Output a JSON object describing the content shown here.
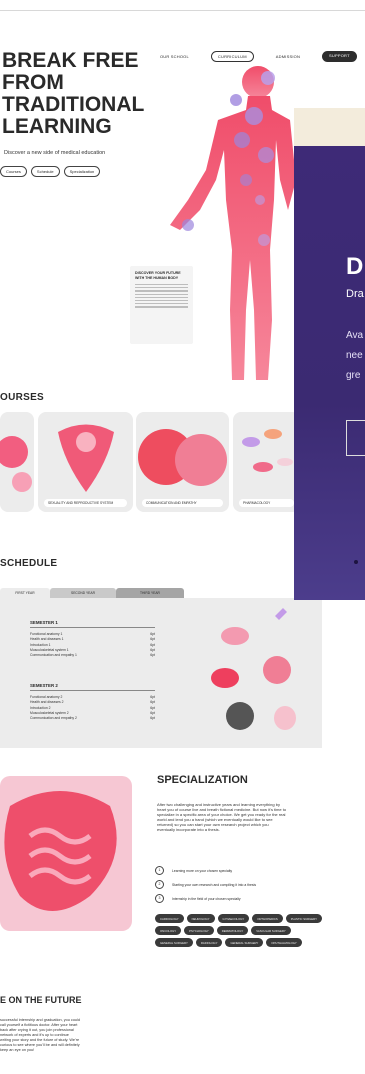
{
  "nav": {
    "items": [
      "OUR SCHOOL",
      "CURRICULUM",
      "ADMISSION",
      "SUPPORT"
    ]
  },
  "hero": {
    "title": "BREAK FREE\nFROM\nTRADITIONAL\nLEARNING",
    "subtitle": "Discover a new side of medical education",
    "chips": [
      "Courses",
      "Schedule",
      "Specialization"
    ]
  },
  "note": {
    "title": "DISCOVER YOUR FUTURE WITH THE HUMAN BODY"
  },
  "courses": {
    "heading": "OURSES",
    "cards": [
      {
        "label": ""
      },
      {
        "label": "SEXUALITY AND REPRODUCTIVE SYSTEM"
      },
      {
        "label": "COMMUNICATION AND EMPATHY"
      },
      {
        "label": "PHARMACOLOGY"
      }
    ]
  },
  "schedule": {
    "heading": "SCHEDULE",
    "tabs": [
      "FIRST YEAR",
      "SECOND YEAR",
      "THIRD YEAR"
    ],
    "semesters": [
      {
        "title": "SEMESTER 1",
        "rows": [
          {
            "name": "Functional anatomy 1",
            "val": "6pt"
          },
          {
            "name": "Health and diseases 1",
            "val": "6pt"
          },
          {
            "name": "Introduction 1",
            "val": "6pt"
          },
          {
            "name": "Musculoskeletal system 1",
            "val": "6pt"
          },
          {
            "name": "Communication and empathy 1",
            "val": "6pt"
          }
        ]
      },
      {
        "title": "SEMESTER 2",
        "rows": [
          {
            "name": "Functional anatomy 2",
            "val": "6pt"
          },
          {
            "name": "Health and diseases 2",
            "val": "6pt"
          },
          {
            "name": "Introduction 2",
            "val": "6pt"
          },
          {
            "name": "Musculoskeletal system 2",
            "val": "6pt"
          },
          {
            "name": "Communication and empathy 2",
            "val": "6pt"
          }
        ]
      }
    ]
  },
  "specialization": {
    "title": "SPECIALIZATION",
    "text": "After two challenging and instructive years and learning everything by heart you of course live and breath fictional medicine. But now it's time to specialize in a specific area of your choice. We get you ready for the real world and lend you a hand (which we eventually would like to see returned) so you can start your own research project which you eventually incorporate into a thesis.",
    "steps": [
      {
        "num": "1",
        "text": "Learning more on your chosen specialty"
      },
      {
        "num": "2",
        "text": "Starting your own research and compiling it into a thesis"
      },
      {
        "num": "3",
        "text": "Internship in the field of your chosen specialty"
      }
    ],
    "tags": [
      "CARDIOLOGY",
      "NEUROLOGY",
      "GYNAECOLOGY",
      "ORTHOPEDICS",
      "PLASTIC SURGERY",
      "ONCOLOGY",
      "PSYCHOLOGY",
      "DERMATOLOGY",
      "VASCULAR SURGERY",
      "GENERAL SURGERY",
      "RADIOLOGY",
      "GENERAL SURGERY",
      "OPHTHALMOLOGY"
    ]
  },
  "future": {
    "title": "E ON THE FUTURE",
    "text": "successful internship and graduation, you could call yourself a fictitious doctor. After your heart back after crying it out, you join professional network of experts and it's up to continue writing your story and the future of study. We're curious to see where you'll be and will definitely keep an eye on you!"
  },
  "banner": {
    "big": "D",
    "sub": "Dra",
    "lines": [
      "Ava",
      "nee",
      "gre"
    ]
  }
}
